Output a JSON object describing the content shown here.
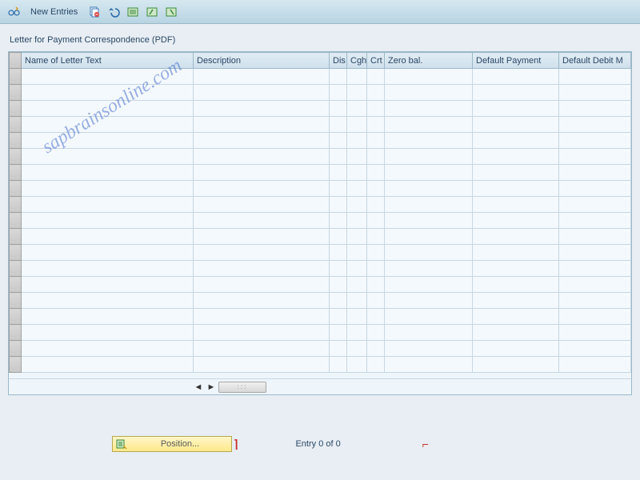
{
  "toolbar": {
    "new_entries": "New Entries"
  },
  "panel": {
    "title": "Letter for Payment Correspondence (PDF)"
  },
  "columns": {
    "name": "Name of Letter Text",
    "desc": "Description",
    "dis": "Dis",
    "cgh": "Cgh",
    "crt": "Crt",
    "zero": "Zero bal.",
    "defp": "Default Payment",
    "defd": "Default Debit M"
  },
  "rows": [],
  "row_count": 19,
  "footer": {
    "position": "Position...",
    "entry": "Entry 0 of 0"
  },
  "watermark": "sapbrainsonline.com"
}
